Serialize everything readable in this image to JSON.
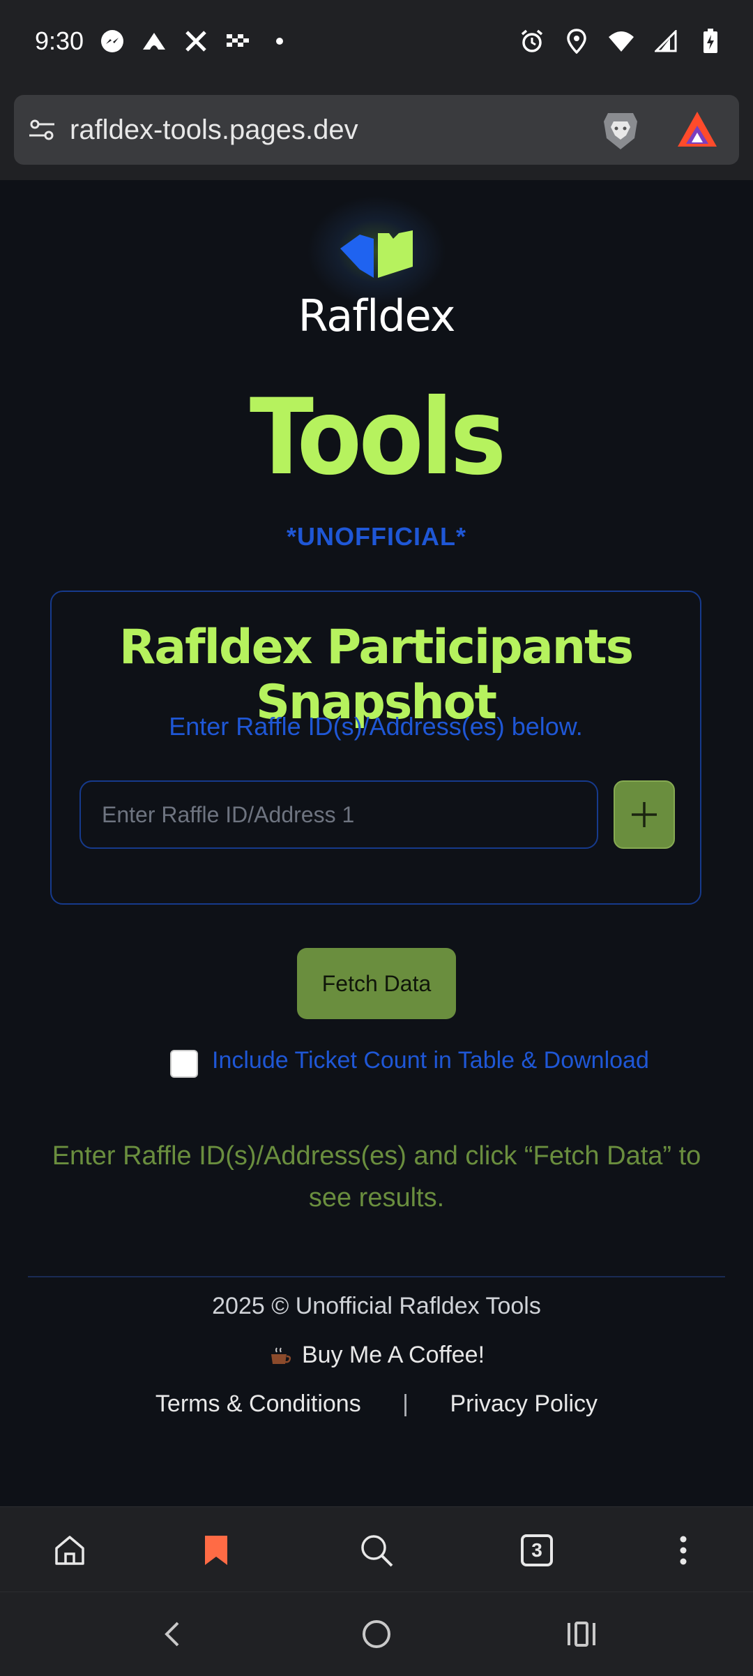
{
  "status_bar": {
    "time": "9:30",
    "left_icons": [
      "messenger-icon",
      "cloud-icon",
      "x-icon",
      "checkered-flag-icon",
      "dot-icon"
    ],
    "right_icons": [
      "alarm-icon",
      "location-icon",
      "wifi-icon",
      "signal-icon",
      "battery-charging-icon"
    ]
  },
  "browser": {
    "url": "rafldex-tools.pages.dev",
    "tab_count": "3"
  },
  "header": {
    "brand": "Rafldex",
    "title": "Tools",
    "subtitle": "*UNOFFICIAL*"
  },
  "snapshot_card": {
    "title": "Rafldex Participants Snapshot",
    "instruction": "Enter Raffle ID(s)/Address(es) below.",
    "input_placeholder": "Enter Raffle ID/Address 1",
    "input_value": "",
    "add_button_label": "+"
  },
  "actions": {
    "fetch_label": "Fetch Data",
    "ticket_count_label": "Include Ticket Count in Table & Download",
    "ticket_count_checked": false
  },
  "hint": "Enter Raffle ID(s)/Address(es) and click “Fetch Data” to see results.",
  "footer": {
    "copyright": "2025 © Unofficial Rafldex Tools",
    "coffee_label": "Buy Me A Coffee!",
    "terms_label": "Terms & Conditions",
    "separator": "|",
    "privacy_label": "Privacy Policy"
  },
  "colors": {
    "accent_green": "#b6f25e",
    "button_green": "#6a8e3e",
    "accent_blue": "#1f57d6",
    "background": "#0e1117",
    "bookmark_orange": "#ff6b45"
  }
}
